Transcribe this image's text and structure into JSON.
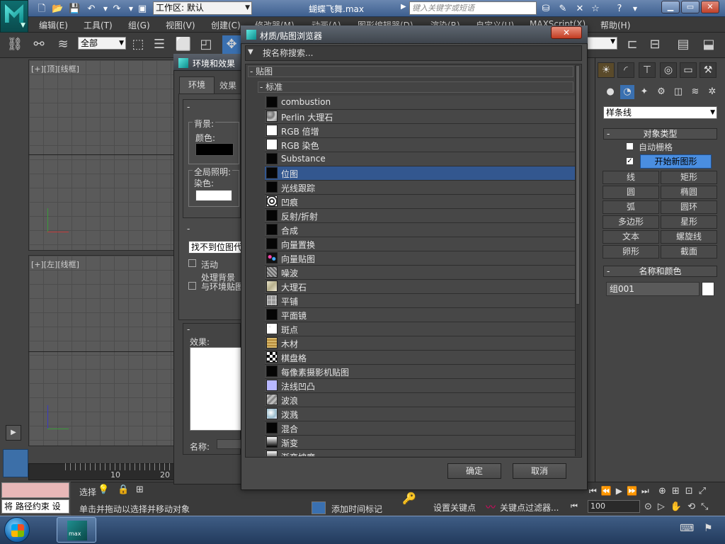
{
  "titlebar": {
    "workspace": "工作区: 默认",
    "window_title": "蝴蝶飞舞.max",
    "search_placeholder": "键入关键字或短语"
  },
  "menu": [
    "编辑(E)",
    "工具(T)",
    "组(G)",
    "视图(V)",
    "创建(C)",
    "修改器(M)",
    "动画(A)",
    "图形编辑器(D)",
    "渲染(R)",
    "自定义(U)",
    "MAXScript(X)",
    "帮助(H)"
  ],
  "toolbar": {
    "selection_filter": "全部"
  },
  "viewports": {
    "top_label": "[+][顶][线框]",
    "left_label": "[+][左][线框]"
  },
  "environment_dialog": {
    "title": "环境和效果",
    "tab_environment": "环境",
    "tab_effects": "效果",
    "background_group": "背景:",
    "color_label": "颜色:",
    "global_light_label": "全局照明:",
    "tint_label": "染色:",
    "bitmap_button": "找不到位图代理",
    "active_label": "活动",
    "process_label": "处理背景\n与环境贴图",
    "effects_label": "效果:",
    "name_label": "名称:"
  },
  "material_browser": {
    "title": "材质/贴图浏览器",
    "search_placeholder": "按名称搜索...",
    "group_maps": "- 贴图",
    "group_standard": "- 标准",
    "items": [
      {
        "label": "combustion",
        "swatch": "black"
      },
      {
        "label": "Perlin 大理石",
        "swatch": "perlin"
      },
      {
        "label": "RGB 倍增",
        "swatch": "white"
      },
      {
        "label": "RGB 染色",
        "swatch": "white"
      },
      {
        "label": "Substance",
        "swatch": "black"
      },
      {
        "label": "位图",
        "swatch": "black",
        "selected": true
      },
      {
        "label": "光线跟踪",
        "swatch": "black"
      },
      {
        "label": "凹痕",
        "swatch": "dent"
      },
      {
        "label": "反射/折射",
        "swatch": "black"
      },
      {
        "label": "合成",
        "swatch": "black"
      },
      {
        "label": "向量置换",
        "swatch": "black"
      },
      {
        "label": "向量贴图",
        "swatch": "vec"
      },
      {
        "label": "噪波",
        "swatch": "noise"
      },
      {
        "label": "大理石",
        "swatch": "marble"
      },
      {
        "label": "平铺",
        "swatch": "tile"
      },
      {
        "label": "平面镜",
        "swatch": "black"
      },
      {
        "label": "斑点",
        "swatch": "speckle"
      },
      {
        "label": "木材",
        "swatch": "wood"
      },
      {
        "label": "棋盘格",
        "swatch": "checker"
      },
      {
        "label": "每像素摄影机贴图",
        "swatch": "black"
      },
      {
        "label": "法线凹凸",
        "swatch": "normal"
      },
      {
        "label": "波浪",
        "swatch": "wave"
      },
      {
        "label": "泼溅",
        "swatch": "splat"
      },
      {
        "label": "混合",
        "swatch": "black"
      },
      {
        "label": "渐变",
        "swatch": "gradient"
      },
      {
        "label": "渐变坡度",
        "swatch": "gradient"
      }
    ],
    "ok_label": "确定",
    "cancel_label": "取消"
  },
  "command_panel": {
    "category": "样条线",
    "object_type_title": "对象类型",
    "auto_grid_label": "自动栅格",
    "start_new_shape": "开始新图形",
    "shapes": [
      "线",
      "矩形",
      "圆",
      "椭圆",
      "弧",
      "圆环",
      "多边形",
      "星形",
      "文本",
      "螺旋线",
      "卵形",
      "截面"
    ],
    "name_color_title": "名称和颜色",
    "object_name": "组001"
  },
  "status": {
    "left_prompt": "将 路径约束 设",
    "select_label": "选择",
    "prompt": "单击并拖动以选择并移动对象",
    "add_time_tag": "添加时间标记",
    "set_key": "设置关键点",
    "key_filter": "关键点过滤器...",
    "frame_value": "100",
    "timeline_10": "10",
    "timeline_20": "20"
  }
}
